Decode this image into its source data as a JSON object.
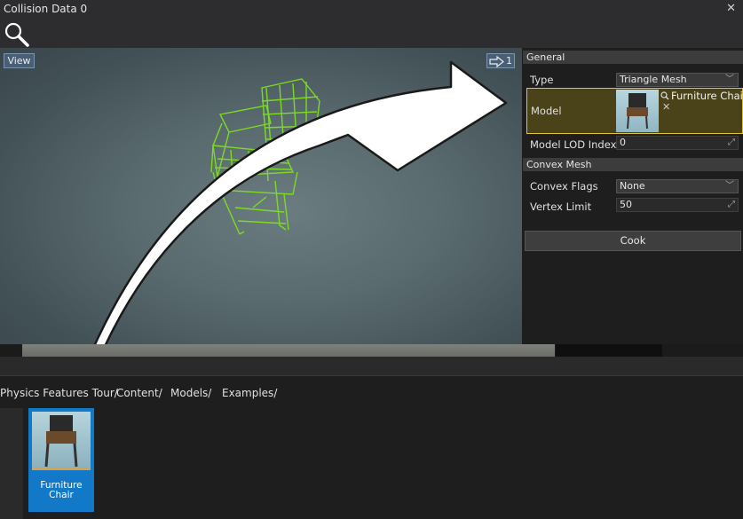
{
  "window": {
    "title": "Collision Data 0",
    "close_glyph": "✕"
  },
  "toolbar": {
    "search_icon": "magnifier-icon"
  },
  "viewport": {
    "view_label": "View",
    "camera_speed_value": "1",
    "annotation": "white-curved-arrow-pointing-to-model-field"
  },
  "properties": {
    "general_header": "General",
    "type_label": "Type",
    "type_value": "Triangle Mesh",
    "model_label": "Model",
    "model_value": "Furniture Chair",
    "model_clear_glyph": "✕",
    "lod_label": "Model LOD Index",
    "lod_value": "0",
    "convex_header": "Convex Mesh",
    "convex_flags_label": "Convex Flags",
    "convex_flags_value": "None",
    "vertex_limit_label": "Vertex Limit",
    "vertex_limit_value": "50",
    "cook_label": "Cook",
    "highlight_color": "#e2c43a"
  },
  "breadcrumb": [
    "Physics Features Tour/",
    "Content/",
    "Models/",
    "Examples/"
  ],
  "content_browser": {
    "selected_asset_label": "Furniture Chair",
    "selected_color": "#1279c8"
  }
}
